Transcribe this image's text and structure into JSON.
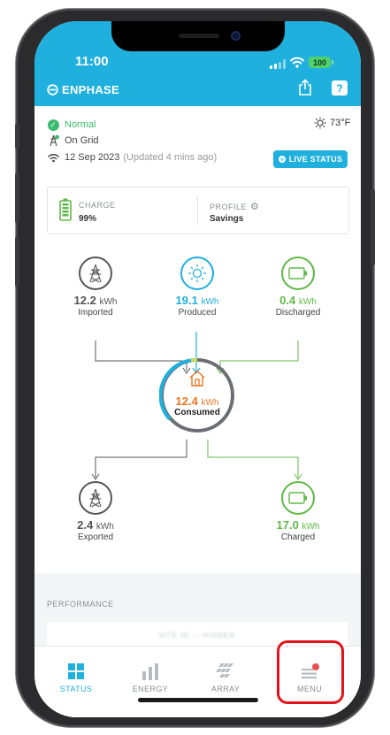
{
  "status_bar": {
    "time": "11:00",
    "battery": "100"
  },
  "header": {
    "brand": "ENPHASE"
  },
  "system": {
    "status": "Normal",
    "grid": "On Grid",
    "date": "12 Sep 2023",
    "updated": "(Updated 4 mins ago)",
    "temperature": "73°F",
    "live_status_label": "LIVE STATUS"
  },
  "battery_card": {
    "charge_label": "CHARGE",
    "charge_value": "99%",
    "profile_label": "PROFILE",
    "profile_value": "Savings"
  },
  "energy_flow": {
    "unit": "kWh",
    "imported": {
      "value": "12.2",
      "label": "Imported"
    },
    "produced": {
      "value": "19.1",
      "label": "Produced"
    },
    "discharged": {
      "value": "0.4",
      "label": "Discharged"
    },
    "consumed": {
      "value": "12.4",
      "label": "Consumed"
    },
    "exported": {
      "value": "2.4",
      "label": "Exported"
    },
    "charged": {
      "value": "17.0",
      "label": "Charged"
    }
  },
  "performance": {
    "title": "PERFORMANCE",
    "site_text": "SITE ID — HIDDEN"
  },
  "tabs": [
    {
      "label": "STATUS",
      "active": true
    },
    {
      "label": "ENERGY",
      "active": false
    },
    {
      "label": "ARRAY",
      "active": false
    },
    {
      "label": "MENU",
      "active": false
    }
  ],
  "colors": {
    "brand_blue": "#1fb0de",
    "solar_blue": "#1fb0de",
    "battery_green": "#5fb946",
    "consumption_orange": "#e87722",
    "grid_gray": "#555555",
    "highlight_red": "#e0151b"
  }
}
